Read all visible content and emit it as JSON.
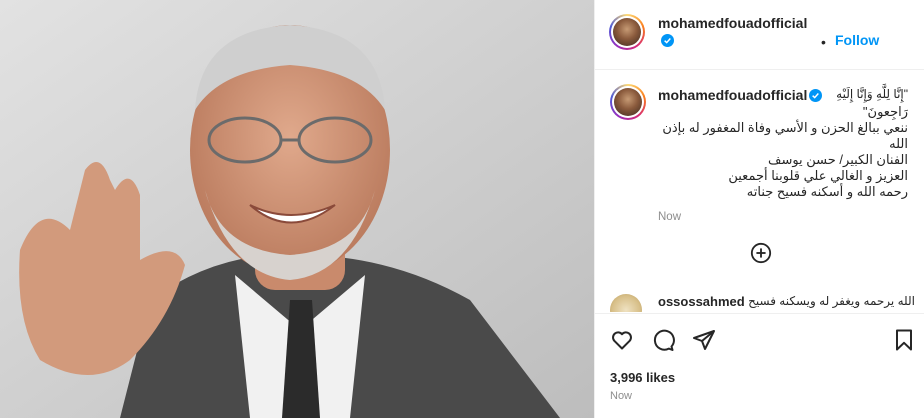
{
  "post": {
    "username": "mohamedfouadofficial",
    "follow_label": "Follow",
    "separator": "•",
    "more_label": "•••",
    "caption": {
      "lines": [
        "\"إِنَّا لِلَّهِ وَإِنَّا إِلَيْهِ",
        "رَاجِعونَ\"",
        "ننعي ببالغ الحزن و الأسي وفاة المغفور له بإذن الله",
        "الفنان الكبير/ حسن يوسف",
        "العزيز و الغالي علي قلوبنا أجمعين",
        "رحمه الله و أسكنه فسيح جناته"
      ],
      "time": "Now"
    },
    "comment": {
      "username": "ossossahmed",
      "text": "الله يرحمه ويغفر له ويسكنه فسيح"
    },
    "likes": "3,996 likes",
    "time": "Now"
  },
  "icons": {
    "verified": "verified-badge-icon",
    "add_comment": "plus-circle-icon",
    "like": "heart-icon",
    "comment": "comment-bubble-icon",
    "share": "paper-plane-icon",
    "save": "bookmark-icon"
  },
  "colors": {
    "accent": "#0095f6",
    "text": "#262626",
    "secondary": "#8e8e8e",
    "border": "#efefef"
  }
}
